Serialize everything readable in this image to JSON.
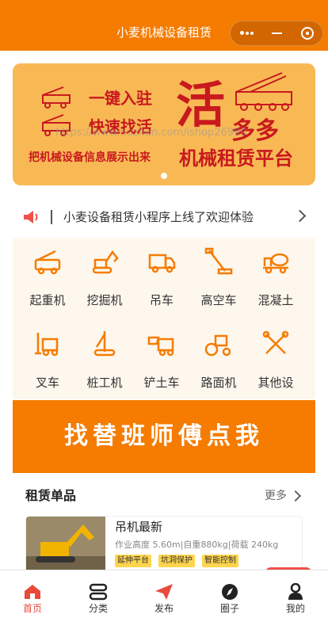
{
  "nav": {
    "title": "小麦机械设备租赁"
  },
  "banner": {
    "line1": "一键入驻",
    "line2": "快速找活",
    "line3": "把机械设备信息展示出来",
    "big": "活",
    "big2": "多多",
    "platform": "机械租赁平台",
    "slide_index": 1,
    "slide_count": 1
  },
  "notice": {
    "text": "小麦设备租赁小程序上线了欢迎体验"
  },
  "categories": [
    {
      "label": "起重机",
      "icon": "crane-truck-icon"
    },
    {
      "label": "挖掘机",
      "icon": "excavator-icon"
    },
    {
      "label": "吊车",
      "icon": "truck-icon"
    },
    {
      "label": "高空车",
      "icon": "aerial-lift-icon"
    },
    {
      "label": "混凝土",
      "icon": "concrete-mixer-icon"
    },
    {
      "label": "叉车",
      "icon": "forklift-icon"
    },
    {
      "label": "桩工机",
      "icon": "pile-driver-icon"
    },
    {
      "label": "铲土车",
      "icon": "loader-icon"
    },
    {
      "label": "路面机",
      "icon": "road-roller-icon"
    },
    {
      "label": "其他设",
      "icon": "tools-icon"
    }
  ],
  "promo": {
    "text": "找替班师傅点我"
  },
  "section": {
    "title": "租赁单品",
    "more": "更多",
    "product": {
      "name": "吊机最新",
      "desc": "作业高度 5.60m|自重880kg|荷载 240kg",
      "tags": [
        "延伸平台",
        "坑洞保护",
        "智能控制"
      ]
    }
  },
  "watermark": "https://www.huzhan.com/ishop26990",
  "tabs": [
    {
      "label": "首页",
      "icon": "home-icon",
      "active": true
    },
    {
      "label": "分类",
      "icon": "category-icon",
      "active": false
    },
    {
      "label": "发布",
      "icon": "send-icon",
      "active": false
    },
    {
      "label": "圈子",
      "icon": "compass-icon",
      "active": false
    },
    {
      "label": "我的",
      "icon": "user-icon",
      "active": false
    }
  ],
  "colors": {
    "brand": "#f57c00",
    "banner_bg": "#f8b955",
    "banner_text": "#c8191e",
    "active_tab": "#e84a3c",
    "tag": "#ffd54f"
  }
}
